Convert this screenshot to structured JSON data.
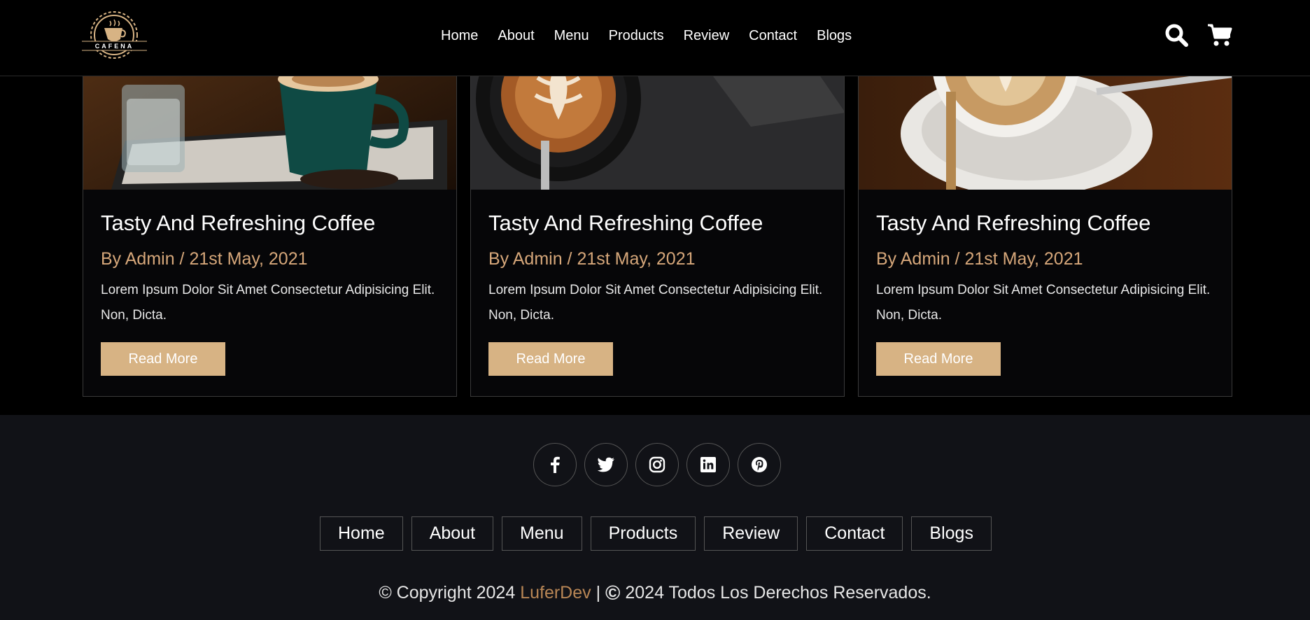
{
  "header": {
    "logo_text": "CAFENA",
    "nav": [
      "Home",
      "About",
      "Menu",
      "Products",
      "Review",
      "Contact",
      "Blogs"
    ],
    "icons": [
      "search-icon",
      "cart-icon"
    ]
  },
  "blog": {
    "cards": [
      {
        "title": "Tasty And Refreshing Coffee",
        "meta": "By Admin / 21st May, 2021",
        "text": "Lorem Ipsum Dolor Sit Amet Consectetur Adipisicing Elit. Non, Dicta.",
        "button": "Read More"
      },
      {
        "title": "Tasty And Refreshing Coffee",
        "meta": "By Admin / 21st May, 2021",
        "text": "Lorem Ipsum Dolor Sit Amet Consectetur Adipisicing Elit. Non, Dicta.",
        "button": "Read More"
      },
      {
        "title": "Tasty And Refreshing Coffee",
        "meta": "By Admin / 21st May, 2021",
        "text": "Lorem Ipsum Dolor Sit Amet Consectetur Adipisicing Elit. Non, Dicta.",
        "button": "Read More"
      }
    ]
  },
  "footer": {
    "social": [
      "facebook-icon",
      "twitter-icon",
      "instagram-icon",
      "linkedin-icon",
      "pinterest-icon"
    ],
    "nav": [
      "Home",
      "About",
      "Menu",
      "Products",
      "Review",
      "Contact",
      "Blogs"
    ],
    "copyright_prefix": "© Copyright 2024",
    "brand": "LuferDev",
    "separator": "|",
    "copyright_symbol": "©",
    "rights": "2024 Todos Los Derechos Reservados."
  },
  "colors": {
    "accent": "#d7b384",
    "meta": "#d6a77a",
    "brand": "#b88655",
    "footer_bg": "#111217"
  }
}
